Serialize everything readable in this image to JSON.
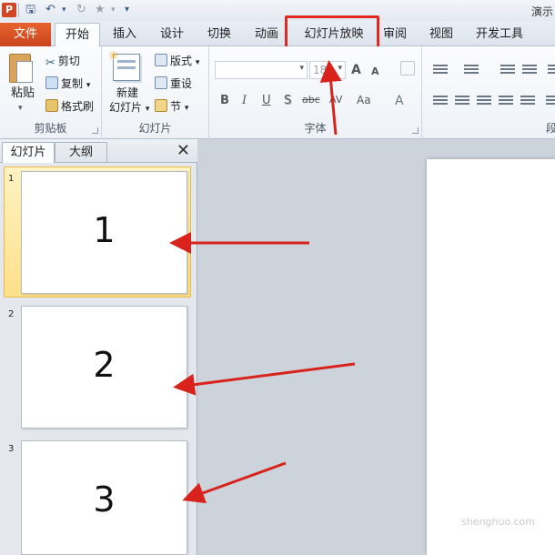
{
  "app": {
    "icon_letter": "P",
    "window_title": "演示"
  },
  "quick_access": {
    "save": "🖫",
    "undo": "↶",
    "redo": "↻",
    "star": "★",
    "customize": "▾"
  },
  "tabs": {
    "file": "文件",
    "items": [
      "开始",
      "插入",
      "设计",
      "切换",
      "动画",
      "幻灯片放映",
      "审阅",
      "视图",
      "开发工具"
    ],
    "active": "开始"
  },
  "ribbon": {
    "clipboard": {
      "paste": "粘贴",
      "cut": "剪切",
      "copy": "复制",
      "format_painter": "格式刷",
      "label": "剪贴板"
    },
    "slides": {
      "new_slide_line1": "新建",
      "new_slide_line2": "幻灯片",
      "layout": "版式",
      "reset": "重设",
      "section": "节",
      "label": "幻灯片"
    },
    "font": {
      "font_name": "",
      "font_size": "18",
      "grow": "A",
      "shrink": "A",
      "bold": "B",
      "italic": "I",
      "underline": "U",
      "shadow": "S",
      "strike": "abc",
      "spacing": "AV",
      "case": "Aa",
      "color": "A",
      "label": "字体"
    },
    "paragraph": {
      "label": "段落"
    }
  },
  "slide_pane": {
    "tab_slides": "幻灯片",
    "tab_outline": "大纲",
    "close": "✕",
    "thumbnails": [
      {
        "number": "1",
        "text": "1"
      },
      {
        "number": "2",
        "text": "2"
      },
      {
        "number": "3",
        "text": "3"
      }
    ]
  },
  "watermark": "shenghuo.com",
  "colors": {
    "file_tab": "#d9542a",
    "highlight": "#e02a1f",
    "arrow": "#d8231c",
    "selection": "#ffe08a"
  }
}
